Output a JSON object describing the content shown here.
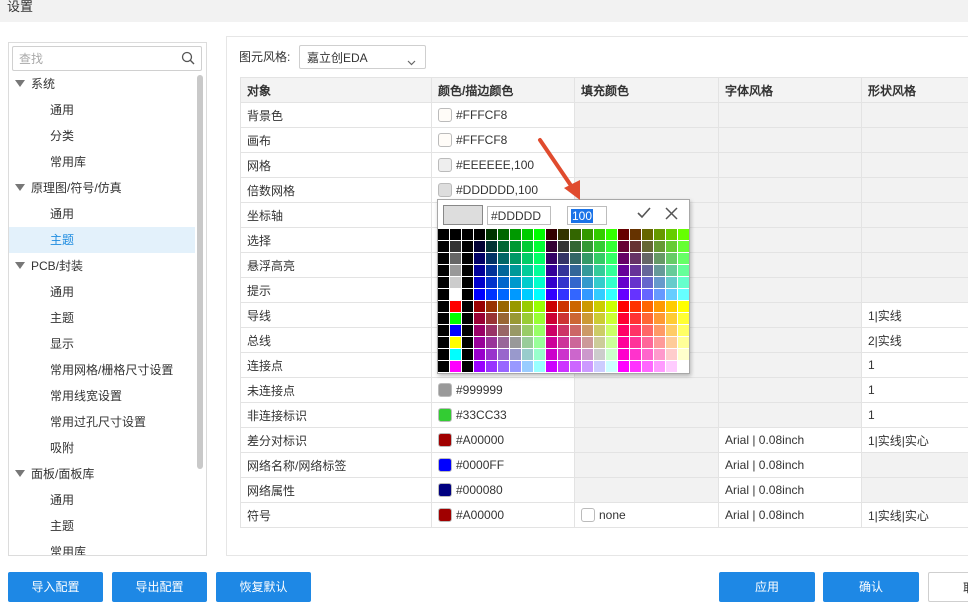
{
  "window": {
    "title": "设置"
  },
  "search": {
    "placeholder": "查找"
  },
  "tree": [
    {
      "label": "系统",
      "level": 0
    },
    {
      "label": "通用",
      "level": 1
    },
    {
      "label": "分类",
      "level": 1
    },
    {
      "label": "常用库",
      "level": 1
    },
    {
      "label": "原理图/符号/仿真",
      "level": 0
    },
    {
      "label": "通用",
      "level": 1
    },
    {
      "label": "主题",
      "level": 1,
      "selected": true
    },
    {
      "label": "PCB/封装",
      "level": 0
    },
    {
      "label": "通用",
      "level": 1
    },
    {
      "label": "主题",
      "level": 1
    },
    {
      "label": "显示",
      "level": 1
    },
    {
      "label": "常用网格/栅格尺寸设置",
      "level": 1
    },
    {
      "label": "常用线宽设置",
      "level": 1
    },
    {
      "label": "常用过孔尺寸设置",
      "level": 1
    },
    {
      "label": "吸附",
      "level": 1
    },
    {
      "label": "面板/面板库",
      "level": 0
    },
    {
      "label": "通用",
      "level": 1
    },
    {
      "label": "主题",
      "level": 1
    },
    {
      "label": "常用库",
      "level": 1
    }
  ],
  "style": {
    "label": "图元风格:",
    "value": "嘉立创EDA"
  },
  "table": {
    "headers": [
      "对象",
      "颜色/描边颜色",
      "填充颜色",
      "字体风格",
      "形状风格"
    ],
    "rows": [
      {
        "obj": "背景色",
        "color": "#FFFCF8",
        "swatch": "#FFFCF8",
        "fill": null,
        "font": "",
        "shape": ""
      },
      {
        "obj": "画布",
        "color": "#FFFCF8",
        "swatch": "#FFFCF8",
        "fill": null,
        "font": "",
        "shape": ""
      },
      {
        "obj": "网格",
        "color": "#EEEEEE,100",
        "swatch": "#EEEEEE",
        "fill": null,
        "font": "",
        "shape": ""
      },
      {
        "obj": "倍数网格",
        "color": "#DDDDDD,100",
        "swatch": "#DDDDDD",
        "fill": null,
        "font": "",
        "shape": ""
      },
      {
        "obj": "坐标轴",
        "color": "",
        "swatch": "",
        "fill": null,
        "font": "",
        "shape": ""
      },
      {
        "obj": "选择",
        "color": "",
        "swatch": "",
        "fill": null,
        "font": "",
        "shape": ""
      },
      {
        "obj": "悬浮高亮",
        "color": "",
        "swatch": "",
        "fill": null,
        "font": "",
        "shape": ""
      },
      {
        "obj": "提示",
        "color": "",
        "swatch": "",
        "fill": null,
        "font": "",
        "shape": ""
      },
      {
        "obj": "导线",
        "color": "",
        "swatch": "",
        "fill": null,
        "font": "",
        "shape": "1|实线"
      },
      {
        "obj": "总线",
        "color": "",
        "swatch": "",
        "fill": null,
        "font": "",
        "shape": "2|实线"
      },
      {
        "obj": "连接点",
        "color": "",
        "swatch": "",
        "fill": null,
        "font": "",
        "shape": "1"
      },
      {
        "obj": "未连接点",
        "color": "#999999",
        "swatch": "#999999",
        "fill": null,
        "font": "",
        "shape": "1"
      },
      {
        "obj": "非连接标识",
        "color": "#33CC33",
        "swatch": "#33CC33",
        "fill": null,
        "font": "",
        "shape": "1"
      },
      {
        "obj": "差分对标识",
        "color": "#A00000",
        "swatch": "#A00000",
        "fill": null,
        "font": "Arial | 0.08inch",
        "shape": "1|实线|实心"
      },
      {
        "obj": "网络名称/网络标签",
        "color": "#0000FF",
        "swatch": "#0000FF",
        "fill": null,
        "font": "Arial | 0.08inch",
        "shape": ""
      },
      {
        "obj": "网络属性",
        "color": "#000080",
        "swatch": "#000080",
        "fill": null,
        "font": "Arial | 0.08inch",
        "shape": ""
      },
      {
        "obj": "符号",
        "color": "#A00000",
        "swatch": "#A00000",
        "fill": "none",
        "font": "Arial | 0.08inch",
        "shape": "1|实线|实心"
      }
    ]
  },
  "picker": {
    "hex": "#DDDDD",
    "alpha": "100",
    "preview": "#DDDDDD"
  },
  "buttons": {
    "import": "导入配置",
    "export": "导出配置",
    "reset": "恢复默认",
    "apply": "应用",
    "ok": "确认",
    "cancel": "取"
  },
  "colors": {
    "primary": "#1E88E5",
    "selected_bg": "#E3F1FB",
    "arrow": "#E04B2E"
  }
}
